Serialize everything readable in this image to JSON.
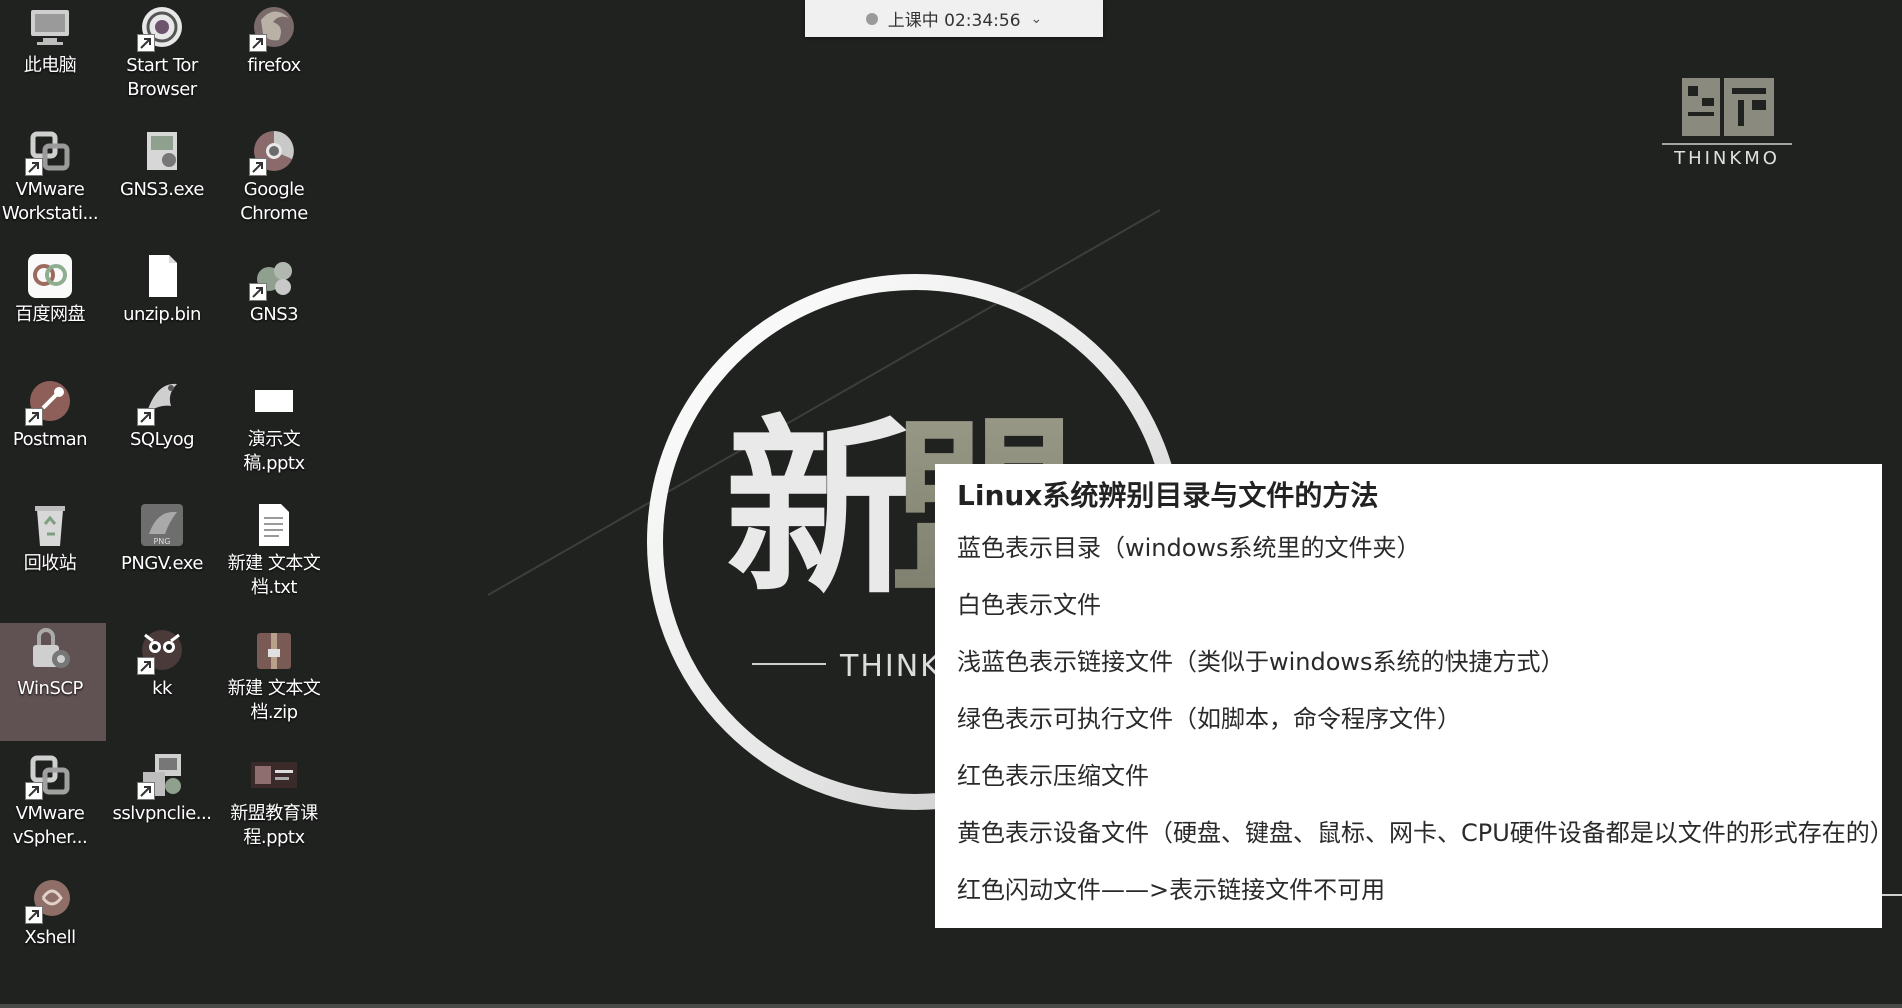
{
  "status": {
    "text": "上课中 02:34:56"
  },
  "logo": {
    "text": "THINKMO"
  },
  "wallpaper": {
    "big_char": "新",
    "big_char2": "盟",
    "brand_text": "THINKM"
  },
  "desktop_icons": [
    {
      "label": "此电脑",
      "icon": "computer-icon"
    },
    {
      "label": "Start Tor Browser",
      "icon": "tor-icon"
    },
    {
      "label": "firefox",
      "icon": "firefox-icon"
    },
    {
      "label": "VMware Workstati...",
      "icon": "vmware-icon"
    },
    {
      "label": "GNS3.exe",
      "icon": "gns3-exe-icon"
    },
    {
      "label": "Google Chrome",
      "icon": "chrome-icon"
    },
    {
      "label": "百度网盘",
      "icon": "baidu-netdisk-icon"
    },
    {
      "label": "unzip.bin",
      "icon": "file-icon"
    },
    {
      "label": "GNS3",
      "icon": "gns3-icon"
    },
    {
      "label": "Postman",
      "icon": "postman-icon"
    },
    {
      "label": "SQLyog",
      "icon": "sqlyog-icon"
    },
    {
      "label": "演示文稿.pptx",
      "icon": "pptx-icon"
    },
    {
      "label": "回收站",
      "icon": "recycle-bin-icon"
    },
    {
      "label": "PNGV.exe",
      "icon": "png-viewer-icon"
    },
    {
      "label": "新建 文本文档.txt",
      "icon": "text-file-icon"
    },
    {
      "label": "WinSCP",
      "icon": "winscp-icon"
    },
    {
      "label": "kk",
      "icon": "kk-icon"
    },
    {
      "label": "新建 文本文档.zip",
      "icon": "zip-archive-icon"
    },
    {
      "label": "VMware vSpher...",
      "icon": "vsphere-icon"
    },
    {
      "label": "sslvpnclie...",
      "icon": "sslvpn-icon"
    },
    {
      "label": "新盟教育课程.pptx",
      "icon": "pptx-thumbnail-icon"
    },
    {
      "label": "Xshell",
      "icon": "xshell-icon"
    }
  ],
  "note": {
    "title": "Linux系统辨别目录与文件的方法",
    "lines": [
      "蓝色表示目录（windows系统里的文件夹）",
      "白色表示文件",
      "浅蓝色表示链接文件（类似于windows系统的快捷方式）",
      "绿色表示可执行文件（如脚本，命令程序文件）",
      "红色表示压缩文件",
      "黄色表示设备文件（硬盘、键盘、鼠标、网卡、CPU硬件设备都是以文件的形式存在的）",
      "红色闪动文件——>表示链接文件不可用"
    ]
  },
  "colors": {
    "background": "#202220",
    "card": "#ffffff",
    "status_bar": "#f0f0f0",
    "selection": "#96787d"
  }
}
